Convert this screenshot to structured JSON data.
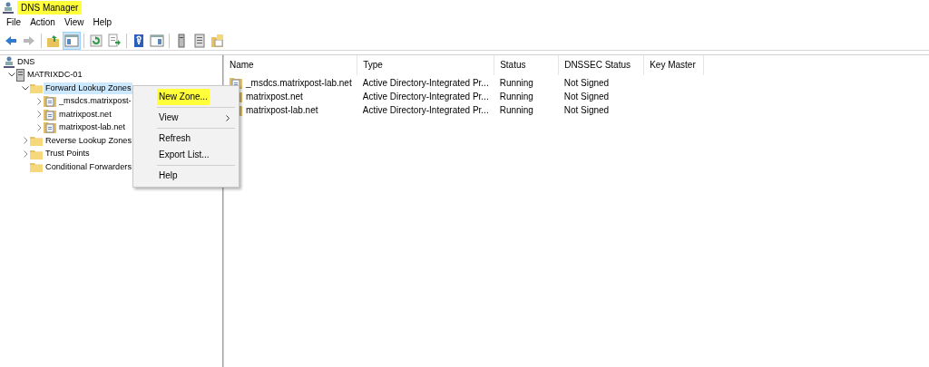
{
  "window": {
    "title": "DNS Manager",
    "title_highlighted": true
  },
  "menu": [
    "File",
    "Action",
    "View",
    "Help"
  ],
  "toolbar": [
    {
      "kind": "back",
      "disabled": false,
      "pressed": false
    },
    {
      "kind": "forward",
      "disabled": true,
      "pressed": false
    },
    {
      "kind": "sep"
    },
    {
      "kind": "up",
      "disabled": false,
      "pressed": false
    },
    {
      "kind": "tree",
      "disabled": false,
      "pressed": true
    },
    {
      "kind": "sep"
    },
    {
      "kind": "refresh",
      "disabled": false,
      "pressed": false
    },
    {
      "kind": "export",
      "disabled": false,
      "pressed": false
    },
    {
      "kind": "sep"
    },
    {
      "kind": "help",
      "disabled": false,
      "pressed": false
    },
    {
      "kind": "panel",
      "disabled": false,
      "pressed": false
    },
    {
      "kind": "sep"
    },
    {
      "kind": "server",
      "disabled": false,
      "pressed": false
    },
    {
      "kind": "list",
      "disabled": false,
      "pressed": false
    },
    {
      "kind": "folders",
      "disabled": false,
      "pressed": false
    }
  ],
  "tree": [
    {
      "label": "DNS",
      "kind": "dns",
      "selected": false,
      "children": [
        {
          "label": "MATRIXDC-01",
          "kind": "server",
          "expanded": true,
          "selected": false,
          "children": [
            {
              "label": "Forward Lookup Zones",
              "kind": "folder",
              "expanded": true,
              "selected": true,
              "children": [
                {
                  "label": "_msdcs.matrixpost-",
                  "kind": "zone",
                  "expanded": false,
                  "selected": false
                },
                {
                  "label": "matrixpost.net",
                  "kind": "zone",
                  "expanded": false,
                  "selected": false
                },
                {
                  "label": "matrixpost-lab.net",
                  "kind": "zone",
                  "expanded": false,
                  "selected": false
                }
              ]
            },
            {
              "label": "Reverse Lookup Zones",
              "kind": "folder",
              "expanded": false,
              "selected": false
            },
            {
              "label": "Trust Points",
              "kind": "folder",
              "expanded": false,
              "selected": false
            },
            {
              "label": "Conditional Forwarders",
              "kind": "folder",
              "selected": false
            }
          ]
        }
      ]
    }
  ],
  "context_menu": [
    {
      "kind": "item",
      "label": "New Zone...",
      "highlighted": true,
      "submenu": false
    },
    {
      "kind": "sep"
    },
    {
      "kind": "item",
      "label": "View",
      "highlighted": false,
      "submenu": true
    },
    {
      "kind": "sep"
    },
    {
      "kind": "item",
      "label": "Refresh",
      "highlighted": false,
      "submenu": false
    },
    {
      "kind": "item",
      "label": "Export List...",
      "highlighted": false,
      "submenu": false
    },
    {
      "kind": "sep"
    },
    {
      "kind": "item",
      "label": "Help",
      "highlighted": false,
      "submenu": false
    }
  ],
  "table": {
    "columns": [
      "Name",
      "Type",
      "Status",
      "DNSSEC Status",
      "Key Master"
    ],
    "rows": [
      [
        "_msdcs.matrixpost-lab.net",
        "Active Directory-Integrated Pr...",
        "Running",
        "Not Signed"
      ],
      [
        "matrixpost.net",
        "Active Directory-Integrated Pr...",
        "Running",
        "Not Signed"
      ],
      [
        "matrixpost-lab.net",
        "Active Directory-Integrated Pr...",
        "Running",
        "Not Signed"
      ]
    ]
  }
}
